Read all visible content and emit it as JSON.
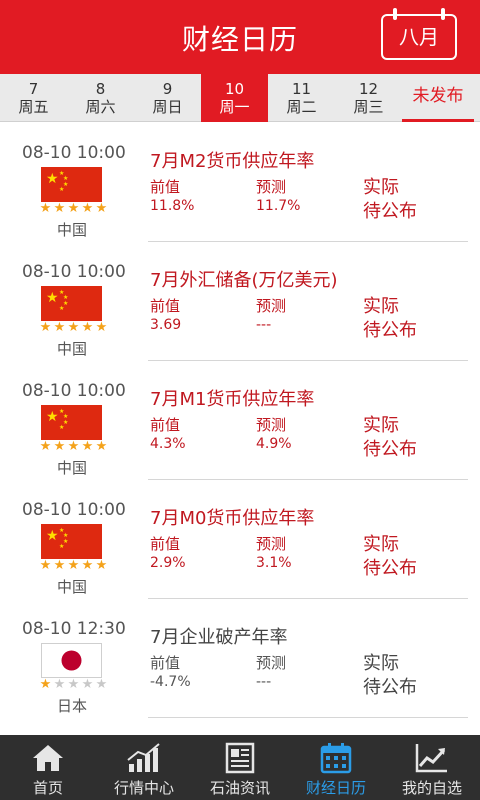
{
  "header": {
    "title": "财经日历",
    "month_label": "八月"
  },
  "colors": {
    "brand_red": "#e11b23",
    "event_red": "#c01820",
    "star": "#f4a21a",
    "nav_active": "#2b9de8",
    "nav_bg": "#2f2f2f"
  },
  "day_tabs": [
    {
      "day": "7",
      "weekday": "周五"
    },
    {
      "day": "8",
      "weekday": "周六"
    },
    {
      "day": "9",
      "weekday": "周日"
    },
    {
      "day": "10",
      "weekday": "周一"
    },
    {
      "day": "11",
      "weekday": "周二"
    },
    {
      "day": "12",
      "weekday": "周三"
    }
  ],
  "selected_day_index": 3,
  "unpublished_tab": "未发布",
  "events": [
    {
      "time": "08-10 10:00",
      "country": "中国",
      "flag_icon": "china-flag-icon",
      "stars": 5,
      "title": "7月M2货币供应年率",
      "prev_label": "前值",
      "prev": "11.8%",
      "forecast_label": "预测",
      "forecast": "11.7%",
      "actual_label": "实际",
      "actual": "待公布",
      "highlight": true
    },
    {
      "time": "08-10 10:00",
      "country": "中国",
      "flag_icon": "china-flag-icon",
      "stars": 5,
      "title": "7月外汇储备(万亿美元)",
      "prev_label": "前值",
      "prev": "3.69",
      "forecast_label": "预测",
      "forecast": "---",
      "actual_label": "实际",
      "actual": "待公布",
      "highlight": true
    },
    {
      "time": "08-10 10:00",
      "country": "中国",
      "flag_icon": "china-flag-icon",
      "stars": 5,
      "title": "7月M1货币供应年率",
      "prev_label": "前值",
      "prev": "4.3%",
      "forecast_label": "预测",
      "forecast": "4.9%",
      "actual_label": "实际",
      "actual": "待公布",
      "highlight": true
    },
    {
      "time": "08-10 10:00",
      "country": "中国",
      "flag_icon": "china-flag-icon",
      "stars": 5,
      "title": "7月M0货币供应年率",
      "prev_label": "前值",
      "prev": "2.9%",
      "forecast_label": "预测",
      "forecast": "3.1%",
      "actual_label": "实际",
      "actual": "待公布",
      "highlight": true
    },
    {
      "time": "08-10 12:30",
      "country": "日本",
      "flag_icon": "japan-flag-icon",
      "stars": 1,
      "title": "7月企业破产年率",
      "prev_label": "前值",
      "prev": "-4.7%",
      "forecast_label": "预测",
      "forecast": "---",
      "actual_label": "实际",
      "actual": "待公布",
      "highlight": false
    }
  ],
  "bottom_nav": [
    {
      "label": "首页",
      "icon": "home-icon"
    },
    {
      "label": "行情中心",
      "icon": "market-chart-icon"
    },
    {
      "label": "石油资讯",
      "icon": "news-icon"
    },
    {
      "label": "财经日历",
      "icon": "calendar-icon"
    },
    {
      "label": "我的自选",
      "icon": "trend-icon"
    }
  ],
  "active_nav_index": 3
}
